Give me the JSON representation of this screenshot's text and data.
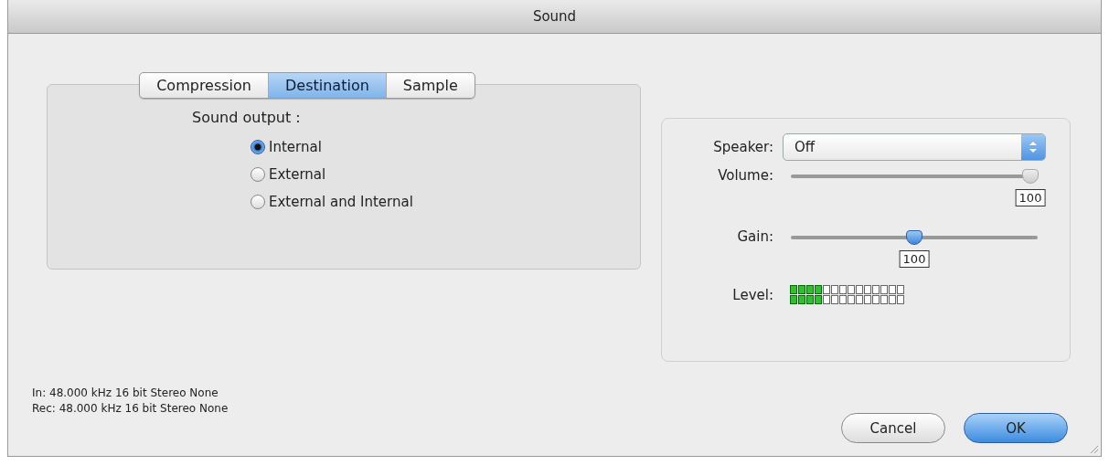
{
  "window": {
    "title": "Sound"
  },
  "tabs": [
    {
      "label": "Compression",
      "selected": false
    },
    {
      "label": "Destination",
      "selected": true
    },
    {
      "label": "Sample",
      "selected": false
    }
  ],
  "output": {
    "label": "Sound output :",
    "options": [
      {
        "label": "Internal",
        "selected": true
      },
      {
        "label": "External",
        "selected": false
      },
      {
        "label": "External and Internal",
        "selected": false
      }
    ]
  },
  "speaker": {
    "label": "Speaker:",
    "value": "Off"
  },
  "sliders": [
    {
      "label": "Volume:",
      "level": 1.0,
      "reading": "100",
      "disabled": true
    },
    {
      "label": "Gain:",
      "level": 0.5,
      "reading": "100",
      "disabled": false
    }
  ],
  "meter": {
    "label": "Level:",
    "channels": [
      {
        "level": 0.286
      },
      {
        "level": 0.286
      }
    ]
  },
  "status": [
    "In: 48.000 kHz 16 bit Stereo None",
    "Rec: 48.000 kHz 16 bit Stereo None"
  ],
  "buttons": [
    {
      "label": "Cancel",
      "kind": "normal"
    },
    {
      "label": "OK",
      "kind": "default"
    }
  ]
}
